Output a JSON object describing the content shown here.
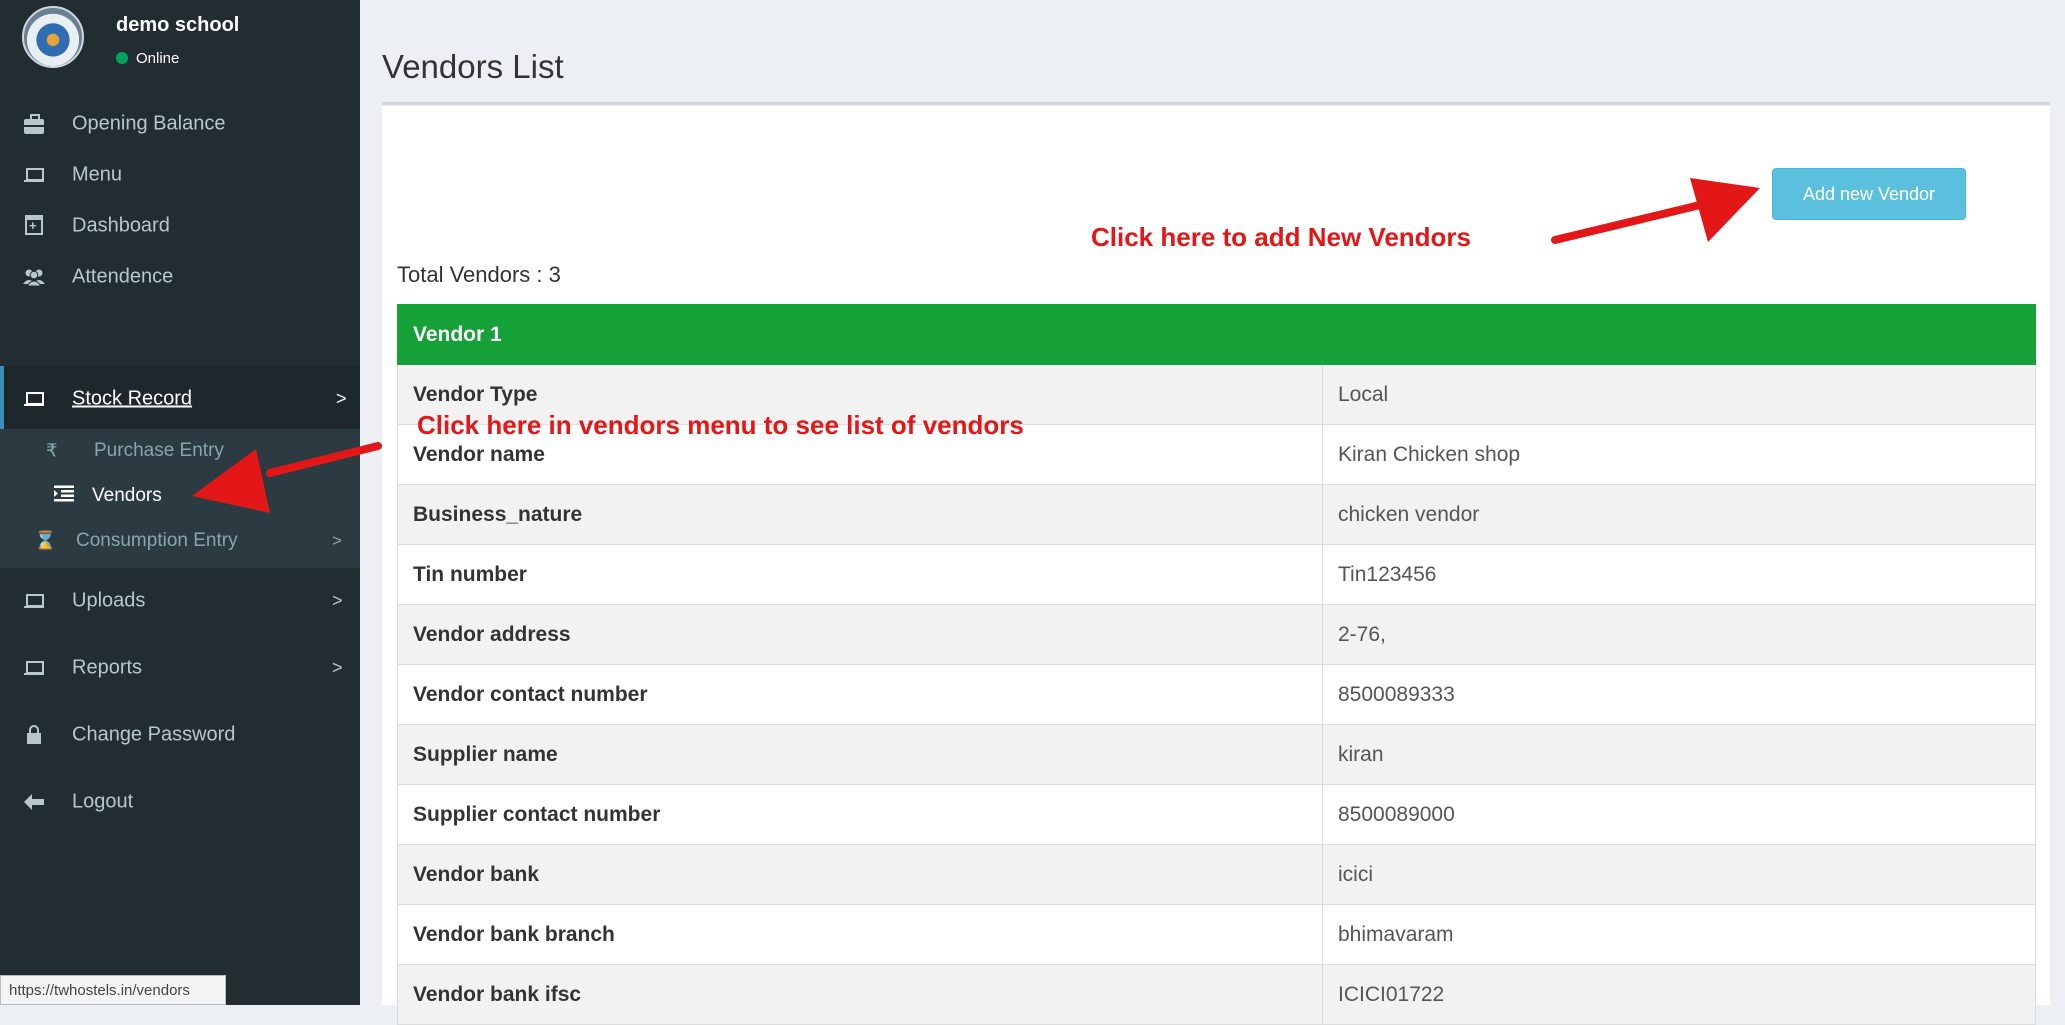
{
  "sidebar": {
    "school_name": "demo school",
    "status": "Online",
    "nav": [
      {
        "label": "Opening Balance",
        "icon": "briefcase-icon"
      },
      {
        "label": "Menu",
        "icon": "laptop-icon"
      },
      {
        "label": "Dashboard",
        "icon": "calendar-plus-icon"
      },
      {
        "label": "Attendence",
        "icon": "users-icon"
      },
      {
        "label": "Stock Record",
        "icon": "laptop-icon",
        "chevron": ">"
      },
      {
        "label": "Uploads",
        "icon": "laptop-icon",
        "chevron": ">"
      },
      {
        "label": "Reports",
        "icon": "laptop-icon",
        "chevron": ">"
      },
      {
        "label": "Change Password",
        "icon": "lock-icon"
      },
      {
        "label": "Logout",
        "icon": "arrow-left-icon"
      }
    ],
    "submenu": [
      {
        "label": "Purchase Entry",
        "icon": "rupee-icon"
      },
      {
        "label": "Vendors",
        "icon": "list-icon"
      },
      {
        "label": "Consumption Entry",
        "icon": "hourglass-icon",
        "chevron": ">"
      }
    ]
  },
  "status_url": "https://twhostels.in/vendors",
  "header": {
    "title": "Vendors List"
  },
  "actions": {
    "add_vendor": "Add new Vendor"
  },
  "summary": {
    "total_vendors": "Total Vendors : 3"
  },
  "annotations": {
    "add": "Click here to add New Vendors",
    "menu": "Click here in vendors menu to see list of vendors"
  },
  "vendor": {
    "title": "Vendor 1",
    "rows": [
      {
        "key": "Vendor Type",
        "value": "Local"
      },
      {
        "key": "Vendor name",
        "value": "Kiran Chicken shop"
      },
      {
        "key": "Business_nature",
        "value": "chicken vendor"
      },
      {
        "key": "Tin number",
        "value": "Tin123456"
      },
      {
        "key": "Vendor address",
        "value": "2-76,"
      },
      {
        "key": "Vendor contact number",
        "value": "8500089333"
      },
      {
        "key": "Supplier name",
        "value": "kiran"
      },
      {
        "key": "Supplier contact number",
        "value": "8500089000"
      },
      {
        "key": "Vendor bank",
        "value": "icici"
      },
      {
        "key": "Vendor bank branch",
        "value": "bhimavaram"
      },
      {
        "key": "Vendor bank ifsc",
        "value": "ICICI01722"
      }
    ]
  },
  "colors": {
    "sidebar_bg": "#222d32",
    "table_header": "#16a138",
    "button": "#5bc0de",
    "annotation": "#e31717"
  }
}
